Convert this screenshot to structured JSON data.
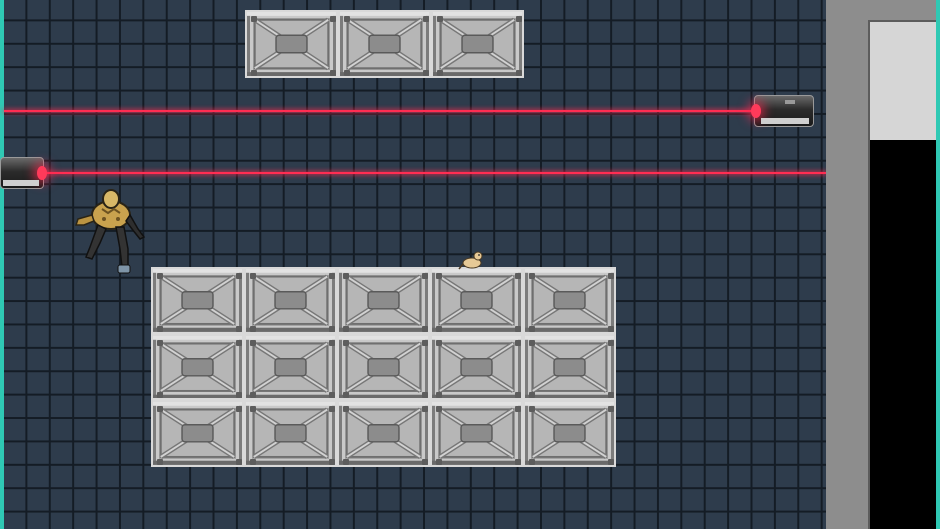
{
  "scene": {
    "type": "top-down stealth game",
    "colors": {
      "floor": "#2e3c4c",
      "grid_lines": "#141c25",
      "laser": "#ff2d52",
      "crate_metal": "#a3a3a3",
      "wall": "#8d8d8d",
      "frame_accent": "#2fc9b4"
    },
    "crate_groups": [
      {
        "name": "top-crate-stack",
        "columns": 3,
        "rows": 1
      },
      {
        "name": "main-crate-stack",
        "columns": 5,
        "rows": 3
      }
    ],
    "lasers": [
      {
        "name": "upper-laser",
        "emitter_side": "right"
      },
      {
        "name": "lower-laser",
        "emitter_side": "left"
      }
    ],
    "characters": [
      {
        "name": "player-character",
        "icon": "armored-humanoid-icon"
      },
      {
        "name": "small-critter",
        "icon": "rat-icon"
      }
    ]
  }
}
